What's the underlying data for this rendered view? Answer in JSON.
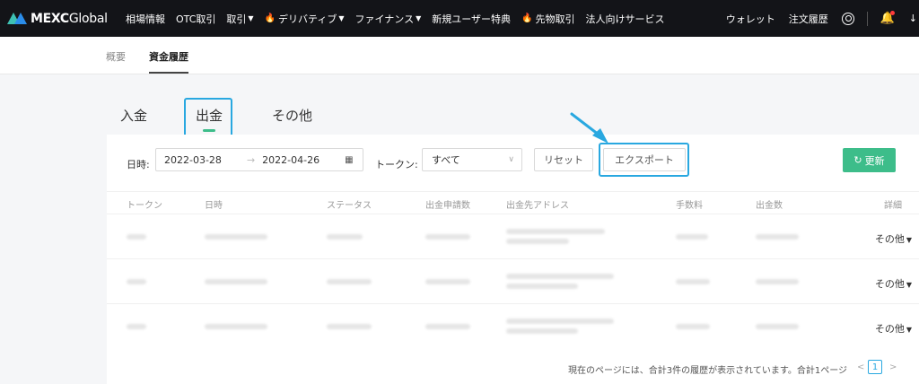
{
  "brand": {
    "name": "MEXC",
    "suffix": "Global"
  },
  "nav": {
    "items": [
      {
        "label": "相場情報",
        "fire": false,
        "chevron": false
      },
      {
        "label": "OTC取引",
        "fire": false,
        "chevron": false
      },
      {
        "label": "取引",
        "fire": false,
        "chevron": true
      },
      {
        "label": "デリバティブ",
        "fire": true,
        "chevron": true
      },
      {
        "label": "ファイナンス",
        "fire": false,
        "chevron": true
      },
      {
        "label": "新規ユーザー特典",
        "fire": false,
        "chevron": false
      },
      {
        "label": "先物取引",
        "fire": true,
        "chevron": false
      },
      {
        "label": "法人向けサービス",
        "fire": false,
        "chevron": false
      }
    ],
    "right": {
      "wallet": "ウォレット",
      "orders": "注文履歴"
    },
    "icons": [
      "user-icon",
      "bell-icon",
      "download-icon"
    ]
  },
  "subnav": {
    "tabs": [
      {
        "label": "概要"
      },
      {
        "label": "資金履歴",
        "active": true
      }
    ]
  },
  "tabs": {
    "deposit": "入金",
    "withdraw": "出金",
    "other": "その他",
    "active": "出金"
  },
  "filters": {
    "date_label": "日時:",
    "date_from": "2022-03-28",
    "date_sep": "→",
    "date_to": "2022-04-26",
    "token_label": "トークン:",
    "token_value": "すべて",
    "reset": "リセット",
    "export": "エクスポート",
    "refresh": "更新"
  },
  "table": {
    "columns": [
      "トークン",
      "日時",
      "ステータス",
      "出金申請数",
      "出金先アドレス",
      "手数料",
      "出金数",
      "詳細"
    ],
    "rows": [
      {
        "detail": "その他"
      },
      {
        "detail": "その他"
      },
      {
        "detail": "その他"
      }
    ]
  },
  "footer": {
    "summary": "現在のページには、合計3件の履歴が表示されています。合計1ページ",
    "prev": "<",
    "page": "1",
    "next": ">"
  },
  "colors": {
    "accent": "#3dbd8a",
    "highlight": "#29a8e0",
    "nav_bg": "#131418"
  }
}
